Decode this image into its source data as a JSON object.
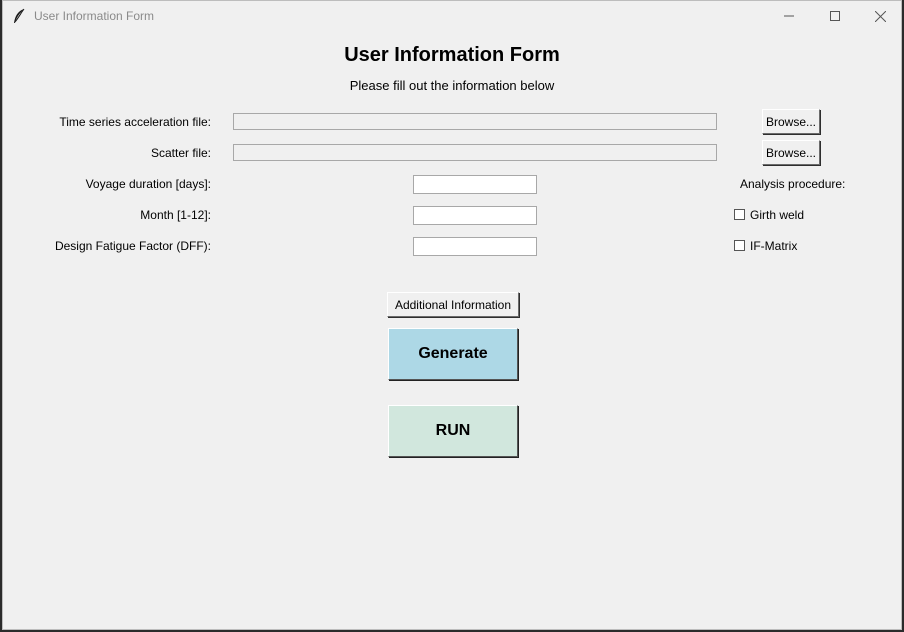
{
  "window": {
    "title": "User Information Form",
    "controls": {
      "minimize": "minimize-icon",
      "maximize": "maximize-icon",
      "close": "close-icon"
    }
  },
  "form": {
    "heading": "User Information Form",
    "subheading": "Please fill out the information below",
    "time_series_label": "Time series acceleration file:",
    "time_series_value": "",
    "scatter_label": "Scatter file:",
    "scatter_value": "",
    "browse_label": "Browse...",
    "voyage_label": "Voyage duration [days]:",
    "voyage_value": "",
    "month_label": "Month [1-12]:",
    "month_value": "",
    "dff_label": "Design Fatigue Factor (DFF):",
    "dff_value": "",
    "analysis_label": "Analysis procedure:",
    "girth_weld_label": "Girth weld",
    "girth_weld_checked": false,
    "if_matrix_label": "IF-Matrix",
    "if_matrix_checked": false,
    "additional_info_label": "Additional Information",
    "generate_label": "Generate",
    "run_label": "RUN"
  },
  "colors": {
    "generate_bg": "#add8e6",
    "run_bg": "#d1e7dd",
    "window_bg": "#f0f0f0"
  }
}
